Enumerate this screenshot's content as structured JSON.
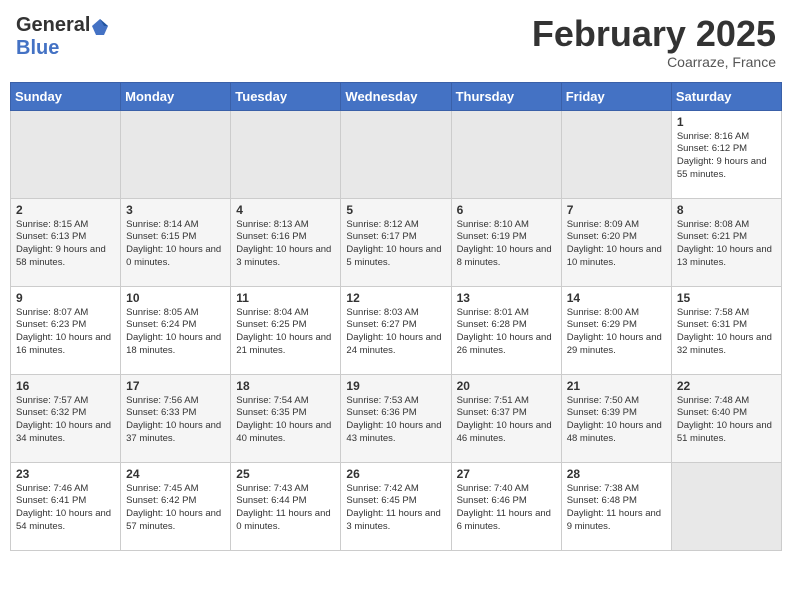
{
  "header": {
    "logo_general": "General",
    "logo_blue": "Blue",
    "month_title": "February 2025",
    "location": "Coarraze, France"
  },
  "days_of_week": [
    "Sunday",
    "Monday",
    "Tuesday",
    "Wednesday",
    "Thursday",
    "Friday",
    "Saturday"
  ],
  "weeks": [
    [
      null,
      null,
      null,
      null,
      null,
      null,
      {
        "day": "1",
        "sunrise": "Sunrise: 8:16 AM",
        "sunset": "Sunset: 6:12 PM",
        "daylight": "Daylight: 9 hours and 55 minutes."
      }
    ],
    [
      {
        "day": "2",
        "sunrise": "Sunrise: 8:15 AM",
        "sunset": "Sunset: 6:13 PM",
        "daylight": "Daylight: 9 hours and 58 minutes."
      },
      {
        "day": "3",
        "sunrise": "Sunrise: 8:14 AM",
        "sunset": "Sunset: 6:15 PM",
        "daylight": "Daylight: 10 hours and 0 minutes."
      },
      {
        "day": "4",
        "sunrise": "Sunrise: 8:13 AM",
        "sunset": "Sunset: 6:16 PM",
        "daylight": "Daylight: 10 hours and 3 minutes."
      },
      {
        "day": "5",
        "sunrise": "Sunrise: 8:12 AM",
        "sunset": "Sunset: 6:17 PM",
        "daylight": "Daylight: 10 hours and 5 minutes."
      },
      {
        "day": "6",
        "sunrise": "Sunrise: 8:10 AM",
        "sunset": "Sunset: 6:19 PM",
        "daylight": "Daylight: 10 hours and 8 minutes."
      },
      {
        "day": "7",
        "sunrise": "Sunrise: 8:09 AM",
        "sunset": "Sunset: 6:20 PM",
        "daylight": "Daylight: 10 hours and 10 minutes."
      },
      {
        "day": "8",
        "sunrise": "Sunrise: 8:08 AM",
        "sunset": "Sunset: 6:21 PM",
        "daylight": "Daylight: 10 hours and 13 minutes."
      }
    ],
    [
      {
        "day": "9",
        "sunrise": "Sunrise: 8:07 AM",
        "sunset": "Sunset: 6:23 PM",
        "daylight": "Daylight: 10 hours and 16 minutes."
      },
      {
        "day": "10",
        "sunrise": "Sunrise: 8:05 AM",
        "sunset": "Sunset: 6:24 PM",
        "daylight": "Daylight: 10 hours and 18 minutes."
      },
      {
        "day": "11",
        "sunrise": "Sunrise: 8:04 AM",
        "sunset": "Sunset: 6:25 PM",
        "daylight": "Daylight: 10 hours and 21 minutes."
      },
      {
        "day": "12",
        "sunrise": "Sunrise: 8:03 AM",
        "sunset": "Sunset: 6:27 PM",
        "daylight": "Daylight: 10 hours and 24 minutes."
      },
      {
        "day": "13",
        "sunrise": "Sunrise: 8:01 AM",
        "sunset": "Sunset: 6:28 PM",
        "daylight": "Daylight: 10 hours and 26 minutes."
      },
      {
        "day": "14",
        "sunrise": "Sunrise: 8:00 AM",
        "sunset": "Sunset: 6:29 PM",
        "daylight": "Daylight: 10 hours and 29 minutes."
      },
      {
        "day": "15",
        "sunrise": "Sunrise: 7:58 AM",
        "sunset": "Sunset: 6:31 PM",
        "daylight": "Daylight: 10 hours and 32 minutes."
      }
    ],
    [
      {
        "day": "16",
        "sunrise": "Sunrise: 7:57 AM",
        "sunset": "Sunset: 6:32 PM",
        "daylight": "Daylight: 10 hours and 34 minutes."
      },
      {
        "day": "17",
        "sunrise": "Sunrise: 7:56 AM",
        "sunset": "Sunset: 6:33 PM",
        "daylight": "Daylight: 10 hours and 37 minutes."
      },
      {
        "day": "18",
        "sunrise": "Sunrise: 7:54 AM",
        "sunset": "Sunset: 6:35 PM",
        "daylight": "Daylight: 10 hours and 40 minutes."
      },
      {
        "day": "19",
        "sunrise": "Sunrise: 7:53 AM",
        "sunset": "Sunset: 6:36 PM",
        "daylight": "Daylight: 10 hours and 43 minutes."
      },
      {
        "day": "20",
        "sunrise": "Sunrise: 7:51 AM",
        "sunset": "Sunset: 6:37 PM",
        "daylight": "Daylight: 10 hours and 46 minutes."
      },
      {
        "day": "21",
        "sunrise": "Sunrise: 7:50 AM",
        "sunset": "Sunset: 6:39 PM",
        "daylight": "Daylight: 10 hours and 48 minutes."
      },
      {
        "day": "22",
        "sunrise": "Sunrise: 7:48 AM",
        "sunset": "Sunset: 6:40 PM",
        "daylight": "Daylight: 10 hours and 51 minutes."
      }
    ],
    [
      {
        "day": "23",
        "sunrise": "Sunrise: 7:46 AM",
        "sunset": "Sunset: 6:41 PM",
        "daylight": "Daylight: 10 hours and 54 minutes."
      },
      {
        "day": "24",
        "sunrise": "Sunrise: 7:45 AM",
        "sunset": "Sunset: 6:42 PM",
        "daylight": "Daylight: 10 hours and 57 minutes."
      },
      {
        "day": "25",
        "sunrise": "Sunrise: 7:43 AM",
        "sunset": "Sunset: 6:44 PM",
        "daylight": "Daylight: 11 hours and 0 minutes."
      },
      {
        "day": "26",
        "sunrise": "Sunrise: 7:42 AM",
        "sunset": "Sunset: 6:45 PM",
        "daylight": "Daylight: 11 hours and 3 minutes."
      },
      {
        "day": "27",
        "sunrise": "Sunrise: 7:40 AM",
        "sunset": "Sunset: 6:46 PM",
        "daylight": "Daylight: 11 hours and 6 minutes."
      },
      {
        "day": "28",
        "sunrise": "Sunrise: 7:38 AM",
        "sunset": "Sunset: 6:48 PM",
        "daylight": "Daylight: 11 hours and 9 minutes."
      },
      null
    ]
  ]
}
